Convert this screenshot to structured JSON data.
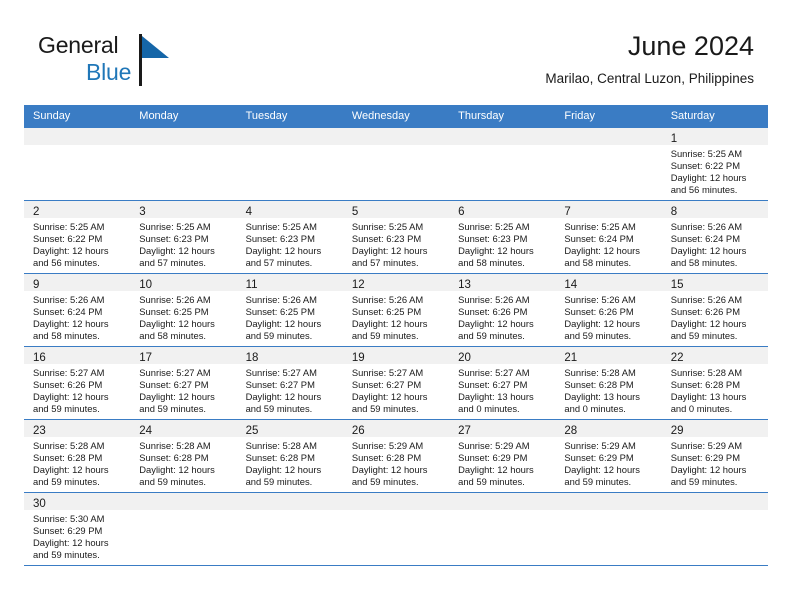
{
  "brand": {
    "name_line1": "General",
    "name_line2": "Blue",
    "flag_icon": "triangle-flag-icon"
  },
  "header": {
    "title": "June 2024",
    "subtitle": "Marilao, Central Luzon, Philippines"
  },
  "colors": {
    "header_blue": "#3a7cc4",
    "brand_blue": "#2077b8",
    "daynum_band": "#f1f1f1",
    "text": "#1a1a1a"
  },
  "weekdays": [
    "Sunday",
    "Monday",
    "Tuesday",
    "Wednesday",
    "Thursday",
    "Friday",
    "Saturday"
  ],
  "weeks": [
    [
      {
        "day": "",
        "sunrise": "",
        "sunset": "",
        "daylight": ""
      },
      {
        "day": "",
        "sunrise": "",
        "sunset": "",
        "daylight": ""
      },
      {
        "day": "",
        "sunrise": "",
        "sunset": "",
        "daylight": ""
      },
      {
        "day": "",
        "sunrise": "",
        "sunset": "",
        "daylight": ""
      },
      {
        "day": "",
        "sunrise": "",
        "sunset": "",
        "daylight": ""
      },
      {
        "day": "",
        "sunrise": "",
        "sunset": "",
        "daylight": ""
      },
      {
        "day": "1",
        "sunrise": "Sunrise: 5:25 AM",
        "sunset": "Sunset: 6:22 PM",
        "daylight": "Daylight: 12 hours and 56 minutes."
      }
    ],
    [
      {
        "day": "2",
        "sunrise": "Sunrise: 5:25 AM",
        "sunset": "Sunset: 6:22 PM",
        "daylight": "Daylight: 12 hours and 56 minutes."
      },
      {
        "day": "3",
        "sunrise": "Sunrise: 5:25 AM",
        "sunset": "Sunset: 6:23 PM",
        "daylight": "Daylight: 12 hours and 57 minutes."
      },
      {
        "day": "4",
        "sunrise": "Sunrise: 5:25 AM",
        "sunset": "Sunset: 6:23 PM",
        "daylight": "Daylight: 12 hours and 57 minutes."
      },
      {
        "day": "5",
        "sunrise": "Sunrise: 5:25 AM",
        "sunset": "Sunset: 6:23 PM",
        "daylight": "Daylight: 12 hours and 57 minutes."
      },
      {
        "day": "6",
        "sunrise": "Sunrise: 5:25 AM",
        "sunset": "Sunset: 6:23 PM",
        "daylight": "Daylight: 12 hours and 58 minutes."
      },
      {
        "day": "7",
        "sunrise": "Sunrise: 5:25 AM",
        "sunset": "Sunset: 6:24 PM",
        "daylight": "Daylight: 12 hours and 58 minutes."
      },
      {
        "day": "8",
        "sunrise": "Sunrise: 5:26 AM",
        "sunset": "Sunset: 6:24 PM",
        "daylight": "Daylight: 12 hours and 58 minutes."
      }
    ],
    [
      {
        "day": "9",
        "sunrise": "Sunrise: 5:26 AM",
        "sunset": "Sunset: 6:24 PM",
        "daylight": "Daylight: 12 hours and 58 minutes."
      },
      {
        "day": "10",
        "sunrise": "Sunrise: 5:26 AM",
        "sunset": "Sunset: 6:25 PM",
        "daylight": "Daylight: 12 hours and 58 minutes."
      },
      {
        "day": "11",
        "sunrise": "Sunrise: 5:26 AM",
        "sunset": "Sunset: 6:25 PM",
        "daylight": "Daylight: 12 hours and 59 minutes."
      },
      {
        "day": "12",
        "sunrise": "Sunrise: 5:26 AM",
        "sunset": "Sunset: 6:25 PM",
        "daylight": "Daylight: 12 hours and 59 minutes."
      },
      {
        "day": "13",
        "sunrise": "Sunrise: 5:26 AM",
        "sunset": "Sunset: 6:26 PM",
        "daylight": "Daylight: 12 hours and 59 minutes."
      },
      {
        "day": "14",
        "sunrise": "Sunrise: 5:26 AM",
        "sunset": "Sunset: 6:26 PM",
        "daylight": "Daylight: 12 hours and 59 minutes."
      },
      {
        "day": "15",
        "sunrise": "Sunrise: 5:26 AM",
        "sunset": "Sunset: 6:26 PM",
        "daylight": "Daylight: 12 hours and 59 minutes."
      }
    ],
    [
      {
        "day": "16",
        "sunrise": "Sunrise: 5:27 AM",
        "sunset": "Sunset: 6:26 PM",
        "daylight": "Daylight: 12 hours and 59 minutes."
      },
      {
        "day": "17",
        "sunrise": "Sunrise: 5:27 AM",
        "sunset": "Sunset: 6:27 PM",
        "daylight": "Daylight: 12 hours and 59 minutes."
      },
      {
        "day": "18",
        "sunrise": "Sunrise: 5:27 AM",
        "sunset": "Sunset: 6:27 PM",
        "daylight": "Daylight: 12 hours and 59 minutes."
      },
      {
        "day": "19",
        "sunrise": "Sunrise: 5:27 AM",
        "sunset": "Sunset: 6:27 PM",
        "daylight": "Daylight: 12 hours and 59 minutes."
      },
      {
        "day": "20",
        "sunrise": "Sunrise: 5:27 AM",
        "sunset": "Sunset: 6:27 PM",
        "daylight": "Daylight: 13 hours and 0 minutes."
      },
      {
        "day": "21",
        "sunrise": "Sunrise: 5:28 AM",
        "sunset": "Sunset: 6:28 PM",
        "daylight": "Daylight: 13 hours and 0 minutes."
      },
      {
        "day": "22",
        "sunrise": "Sunrise: 5:28 AM",
        "sunset": "Sunset: 6:28 PM",
        "daylight": "Daylight: 13 hours and 0 minutes."
      }
    ],
    [
      {
        "day": "23",
        "sunrise": "Sunrise: 5:28 AM",
        "sunset": "Sunset: 6:28 PM",
        "daylight": "Daylight: 12 hours and 59 minutes."
      },
      {
        "day": "24",
        "sunrise": "Sunrise: 5:28 AM",
        "sunset": "Sunset: 6:28 PM",
        "daylight": "Daylight: 12 hours and 59 minutes."
      },
      {
        "day": "25",
        "sunrise": "Sunrise: 5:28 AM",
        "sunset": "Sunset: 6:28 PM",
        "daylight": "Daylight: 12 hours and 59 minutes."
      },
      {
        "day": "26",
        "sunrise": "Sunrise: 5:29 AM",
        "sunset": "Sunset: 6:28 PM",
        "daylight": "Daylight: 12 hours and 59 minutes."
      },
      {
        "day": "27",
        "sunrise": "Sunrise: 5:29 AM",
        "sunset": "Sunset: 6:29 PM",
        "daylight": "Daylight: 12 hours and 59 minutes."
      },
      {
        "day": "28",
        "sunrise": "Sunrise: 5:29 AM",
        "sunset": "Sunset: 6:29 PM",
        "daylight": "Daylight: 12 hours and 59 minutes."
      },
      {
        "day": "29",
        "sunrise": "Sunrise: 5:29 AM",
        "sunset": "Sunset: 6:29 PM",
        "daylight": "Daylight: 12 hours and 59 minutes."
      }
    ],
    [
      {
        "day": "30",
        "sunrise": "Sunrise: 5:30 AM",
        "sunset": "Sunset: 6:29 PM",
        "daylight": "Daylight: 12 hours and 59 minutes."
      },
      {
        "day": "",
        "sunrise": "",
        "sunset": "",
        "daylight": ""
      },
      {
        "day": "",
        "sunrise": "",
        "sunset": "",
        "daylight": ""
      },
      {
        "day": "",
        "sunrise": "",
        "sunset": "",
        "daylight": ""
      },
      {
        "day": "",
        "sunrise": "",
        "sunset": "",
        "daylight": ""
      },
      {
        "day": "",
        "sunrise": "",
        "sunset": "",
        "daylight": ""
      },
      {
        "day": "",
        "sunrise": "",
        "sunset": "",
        "daylight": ""
      }
    ]
  ]
}
